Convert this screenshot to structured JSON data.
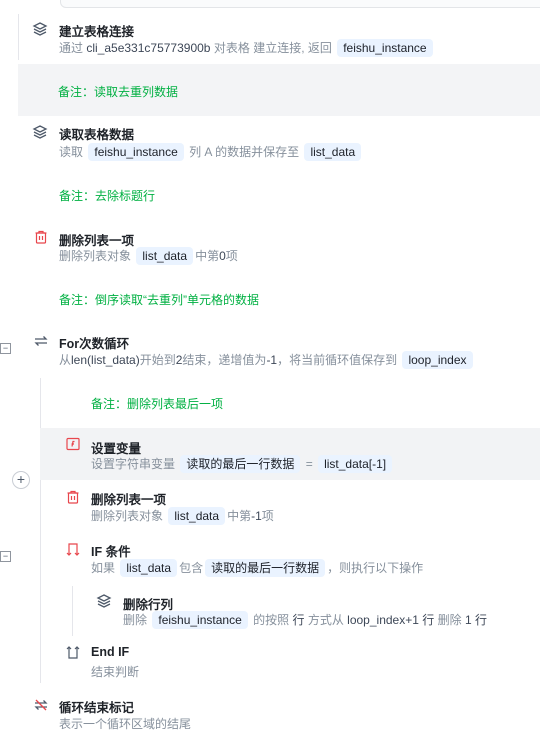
{
  "steps": [
    {
      "title": "建立表格连接",
      "desc": {
        "p1": "通过",
        "v1": "cli_a5e331c75773900b",
        "p2": "对表格",
        "p3": "建立连接, 返回",
        "chip1": "feishu_instance"
      }
    },
    {
      "note": "备注：读取去重列数据"
    },
    {
      "title": "读取表格数据",
      "desc": {
        "p1": "读取",
        "chip1": "feishu_instance",
        "p2": "列 A 的数据并保存至",
        "chip2": "list_data"
      }
    },
    {
      "note": "备注：去除标题行"
    },
    {
      "title": "删除列表一项",
      "desc": {
        "p1": "删除列表对象",
        "chip1": "list_data",
        "p2": "中第",
        "v1": "0",
        "p3": "项"
      }
    },
    {
      "note": "备注：倒序读取“去重列”单元格的数据"
    },
    {
      "title": "For次数循环",
      "desc": {
        "p1": "从",
        "v1": "len(list_data)",
        "p2": "开始到",
        "v2": "2",
        "p3": "结束，递增值为",
        "v3": "-1",
        "p4": "，将当前循环值保存到",
        "chip1": "loop_index"
      }
    },
    {
      "note": "备注：删除列表最后一项"
    },
    {
      "title": "设置变量",
      "desc": {
        "p1": "设置字符串变量",
        "chip1": "读取的最后一行数据",
        "p2": "=",
        "chip2": "list_data[-1]"
      }
    },
    {
      "title": "删除列表一项",
      "desc": {
        "p1": "删除列表对象",
        "chip1": "list_data",
        "p2": "中第",
        "v1": "-1",
        "p3": "项"
      }
    },
    {
      "title": "IF 条件",
      "desc": {
        "p1": "如果",
        "chip1": "list_data",
        "p2": "包含",
        "chip2": "读取的最后一行数据",
        "p3": "，则执行以下操作"
      }
    },
    {
      "title": "删除行列",
      "desc": {
        "p1": "删除",
        "chip1": "feishu_instance",
        "p2": "的按照",
        "v1": "行",
        "p3": "方式从",
        "v2": "loop_index+1",
        "v3": "行",
        "p4": "删除",
        "v4": "1",
        "v5": "行"
      }
    },
    {
      "title": "End IF",
      "desc": {
        "p1": "结束判断"
      }
    },
    {
      "title": "循环结束标记",
      "desc": {
        "p1": "表示一个循环区域的结尾"
      }
    }
  ],
  "controls": {
    "collapse_symbol": "−",
    "add_symbol": "+"
  }
}
